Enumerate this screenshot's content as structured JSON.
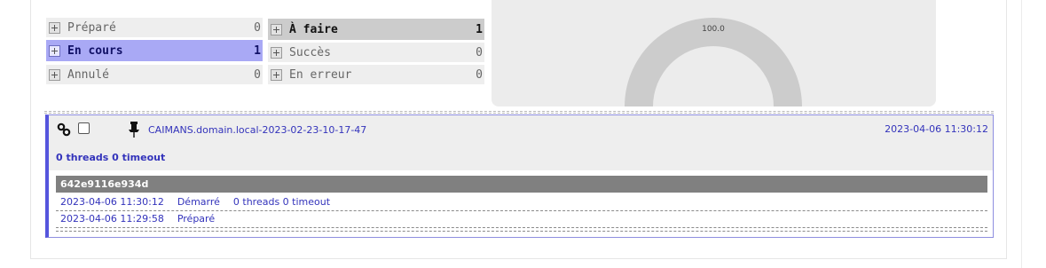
{
  "statuses": {
    "left": [
      {
        "label": "Préparé",
        "count": "0"
      },
      {
        "label": "En cours",
        "count": "1"
      },
      {
        "label": "Annulé",
        "count": "0"
      }
    ],
    "right": [
      {
        "label": "À faire",
        "count": "1"
      },
      {
        "label": "Succès",
        "count": "0"
      },
      {
        "label": "En erreur",
        "count": "0"
      }
    ]
  },
  "chart_data": {
    "type": "pie",
    "variant": "semi-donut",
    "label": "100.0",
    "values": [
      100.0
    ],
    "colors": [
      "#cccccc"
    ]
  },
  "job": {
    "title": "CAIMANS.domain.local-2023-02-23-10-17-47",
    "date": "2023-04-06 11:30:12",
    "threads_summary": "0 threads 0 timeout",
    "run_id": "642e9116e934d",
    "events": [
      {
        "time": "2023-04-06 11:30:12",
        "status": "Démarré",
        "detail": "0 threads 0 timeout"
      },
      {
        "time": "2023-04-06 11:29:58",
        "status": "Préparé",
        "detail": ""
      }
    ]
  },
  "colors": {
    "active_row": "#a9a9f5",
    "highlight_row": "#cccccc",
    "link": "#3333bb",
    "card_border": "#5555dd"
  }
}
